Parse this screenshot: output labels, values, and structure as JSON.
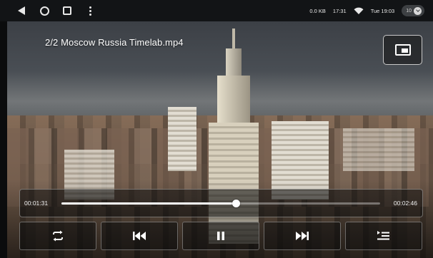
{
  "statusbar": {
    "data_rate": "0.0 KB",
    "clock": "17:31",
    "date_time": "Tue 19:03",
    "volume_level": "10",
    "icons": [
      "back-icon",
      "home-icon",
      "recents-icon",
      "menu-dots-icon",
      "wifi-icon",
      "chevron-down-icon"
    ]
  },
  "player": {
    "title": "2/2 Moscow Russia Timelab.mp4",
    "current_time": "00:01:31",
    "total_time": "00:02:46",
    "progress_fraction": 0.548,
    "pip_icon": "picture-in-picture-icon",
    "controls": [
      {
        "name": "repeat-button",
        "icon": "repeat-icon"
      },
      {
        "name": "previous-button",
        "icon": "skip-previous-icon"
      },
      {
        "name": "pause-button",
        "icon": "pause-icon"
      },
      {
        "name": "next-button",
        "icon": "skip-next-icon"
      },
      {
        "name": "playlist-button",
        "icon": "playlist-icon"
      }
    ]
  },
  "colors": {
    "statusbar_bg": "#121416",
    "overlay_panel": "#0f0f0f",
    "accent": "#ffffff"
  }
}
